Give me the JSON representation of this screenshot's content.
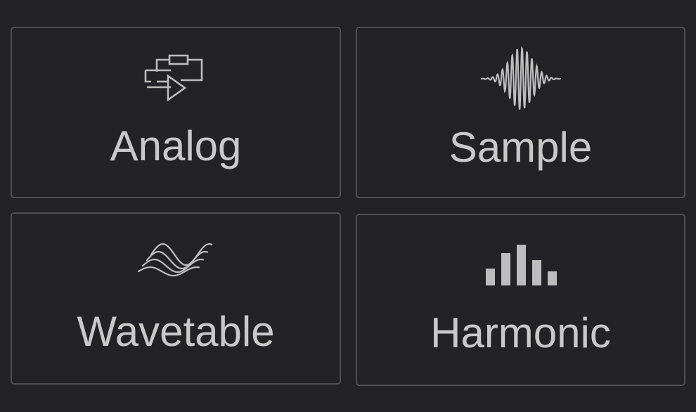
{
  "tiles": [
    {
      "label": "Analog",
      "icon": "analog-circuit-icon"
    },
    {
      "label": "Sample",
      "icon": "waveform-icon"
    },
    {
      "label": "Wavetable",
      "icon": "wavetable-icon"
    },
    {
      "label": "Harmonic",
      "icon": "harmonic-bars-icon"
    }
  ],
  "colors": {
    "background": "#232226",
    "border": "#4f4f54",
    "text": "#c9c9c9",
    "icon": "#bdbdbd"
  }
}
